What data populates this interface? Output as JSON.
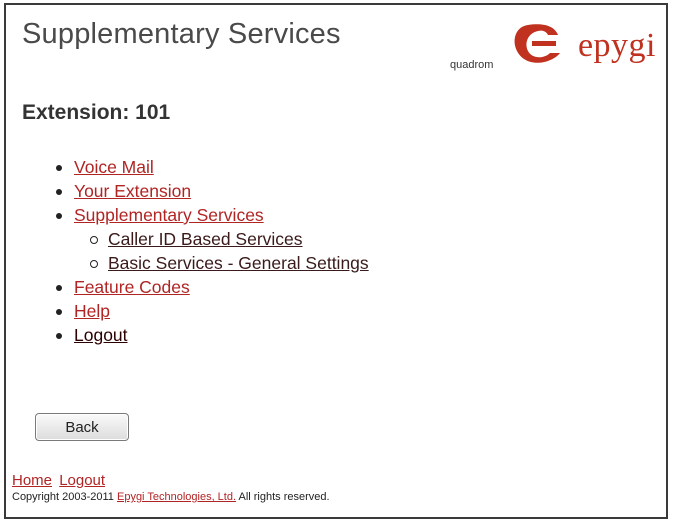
{
  "header": {
    "title": "Supplementary Services",
    "logo_sub": "quadrom",
    "logo_text": "epygi",
    "brand_color": "#c0311f"
  },
  "extension": {
    "label": "Extension: 101"
  },
  "menu": {
    "items": [
      {
        "label": "Voice Mail"
      },
      {
        "label": "Your Extension"
      },
      {
        "label": "Supplementary Services"
      },
      {
        "label": "Caller ID Based Services"
      },
      {
        "label": "Basic Services - General Settings"
      },
      {
        "label": "Feature Codes"
      },
      {
        "label": "Help"
      },
      {
        "label": "Logout"
      }
    ]
  },
  "actions": {
    "back_label": "Back"
  },
  "footer": {
    "home": "Home",
    "logout": "Logout",
    "copyright_prefix": "Copyright 2003-2011",
    "company": "Epygi Technologies, Ltd.",
    "copyright_suffix": "All rights reserved."
  }
}
